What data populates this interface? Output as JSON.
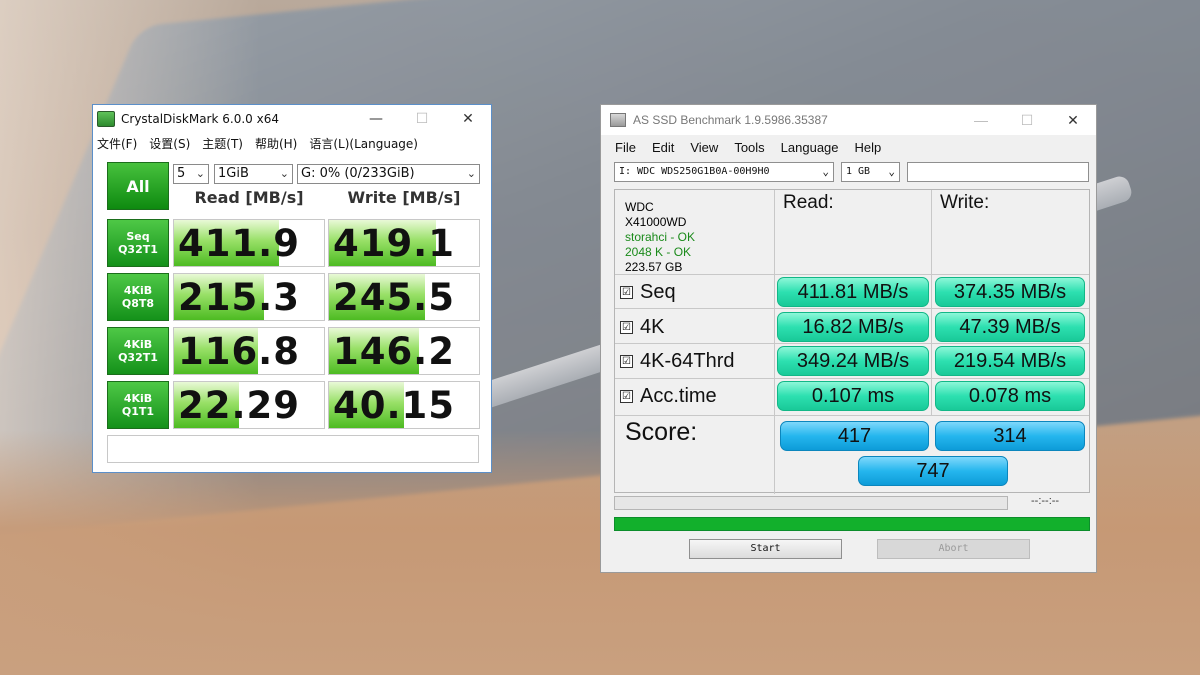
{
  "cdm": {
    "title": "CrystalDiskMark 6.0.0 x64",
    "win_min": "—",
    "win_max": "☐",
    "win_close": "✕",
    "menu": [
      "文件(F)",
      "设置(S)",
      "主题(T)",
      "帮助(H)",
      "语言(L)(Language)"
    ],
    "all_label": "All",
    "count": "5",
    "size": "1GiB",
    "drive": "G: 0% (0/233GiB)",
    "read_header": "Read [MB/s]",
    "write_header": "Write [MB/s]",
    "rows": [
      {
        "l1": "Seq",
        "l2": "Q32T1",
        "read": "411.9",
        "write": "419.1",
        "read_fill": 0.7,
        "write_fill": 0.71
      },
      {
        "l1": "4KiB",
        "l2": "Q8T8",
        "read": "215.3",
        "write": "245.5",
        "read_fill": 0.6,
        "write_fill": 0.64
      },
      {
        "l1": "4KiB",
        "l2": "Q32T1",
        "read": "116.8",
        "write": "146.2",
        "read_fill": 0.56,
        "write_fill": 0.6
      },
      {
        "l1": "4KiB",
        "l2": "Q1T1",
        "read": "22.29",
        "write": "40.15",
        "read_fill": 0.43,
        "write_fill": 0.5
      }
    ],
    "comment": ""
  },
  "asssd": {
    "title": "AS SSD Benchmark 1.9.5986.35387",
    "win_min": "—",
    "win_max": "☐",
    "win_close": "✕",
    "menu": [
      "File",
      "Edit",
      "View",
      "Tools",
      "Language",
      "Help"
    ],
    "drive": "I: WDC WDS250G1B0A-00H9H0",
    "size": "1 GB",
    "info": {
      "line1": "WDC",
      "line2": "X41000WD",
      "line3": "storahci - OK",
      "line4": "2048 K - OK",
      "line5": "223.57 GB"
    },
    "read_header": "Read:",
    "write_header": "Write:",
    "rows": [
      {
        "name": "Seq",
        "read": "411.81 MB/s",
        "write": "374.35 MB/s"
      },
      {
        "name": "4K",
        "read": "16.82 MB/s",
        "write": "47.39 MB/s"
      },
      {
        "name": "4K-64Thrd",
        "read": "349.24 MB/s",
        "write": "219.54 MB/s"
      },
      {
        "name": "Acc.time",
        "read": "0.107 ms",
        "write": "0.078 ms"
      }
    ],
    "check_glyph": "☑",
    "score_label": "Score:",
    "score_read": "417",
    "score_write": "314",
    "score_total": "747",
    "time": "--:--:--",
    "progress": 1.0,
    "start_label": "Start",
    "abort_label": "Abort"
  }
}
